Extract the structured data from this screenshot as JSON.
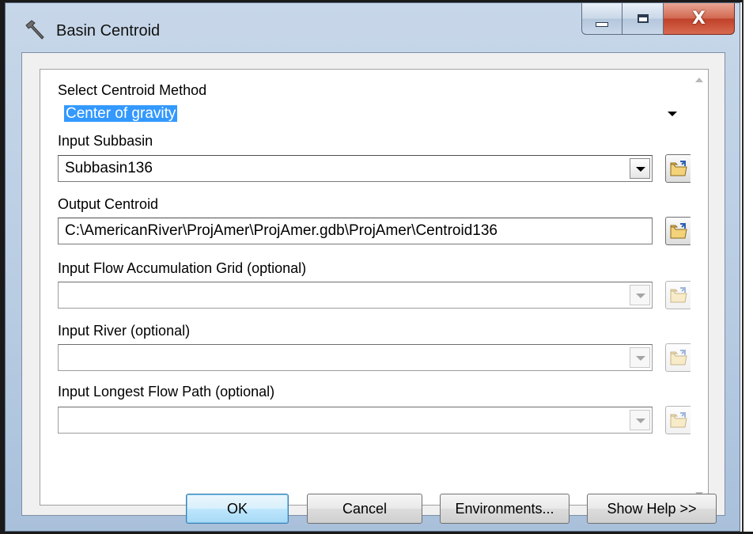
{
  "window": {
    "title": "Basin Centroid",
    "controls": {
      "minimize": "minimize-icon",
      "maximize": "maximize-icon",
      "close_label": "X"
    }
  },
  "form": {
    "method": {
      "label": "Select Centroid Method",
      "value": "Center of gravity"
    },
    "subbasin": {
      "label": "Input Subbasin",
      "value": "Subbasin136"
    },
    "output": {
      "label": "Output Centroid",
      "value": "C:\\AmericanRiver\\ProjAmer\\ProjAmer.gdb\\ProjAmer\\Centroid136"
    },
    "flow_acc": {
      "label": "Input Flow Accumulation Grid (optional)",
      "value": ""
    },
    "river": {
      "label": "Input River (optional)",
      "value": ""
    },
    "longest": {
      "label": "Input Longest Flow Path (optional)",
      "value": ""
    }
  },
  "buttons": {
    "ok": "OK",
    "cancel": "Cancel",
    "environments": "Environments...",
    "help": "Show Help >>"
  },
  "colors": {
    "selection": "#3399ff",
    "close_button": "#c9452e",
    "titlebar": "#b9cce3"
  }
}
